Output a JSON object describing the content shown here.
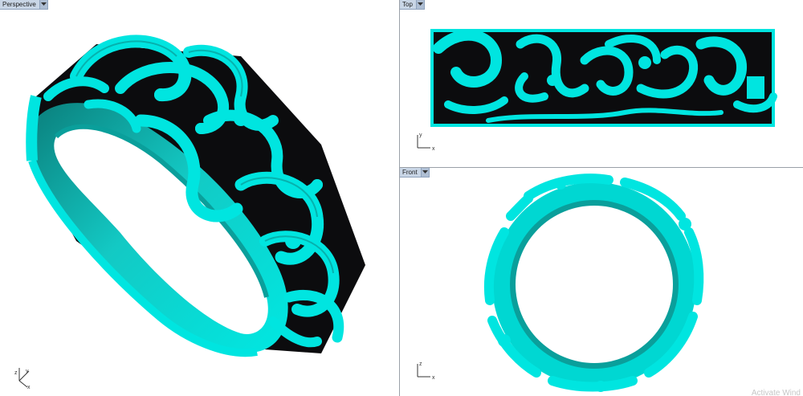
{
  "viewports": {
    "perspective": {
      "label": "Perspective",
      "axes": {
        "x": "x",
        "y": "y",
        "z": "z"
      }
    },
    "top": {
      "label": "Top",
      "axes": {
        "x": "x",
        "y": "y"
      }
    },
    "front": {
      "label": "Front",
      "axes": {
        "x": "x",
        "z": "z"
      }
    }
  },
  "watermark": "Activate Wind",
  "colors": {
    "model": "#00e5e0",
    "model_shadow": "#0a8f8c",
    "cavity": "#0c0c0e",
    "tab_bg": "#c9d6e6"
  },
  "icons": {
    "dropdown": "chevron-down-icon"
  }
}
